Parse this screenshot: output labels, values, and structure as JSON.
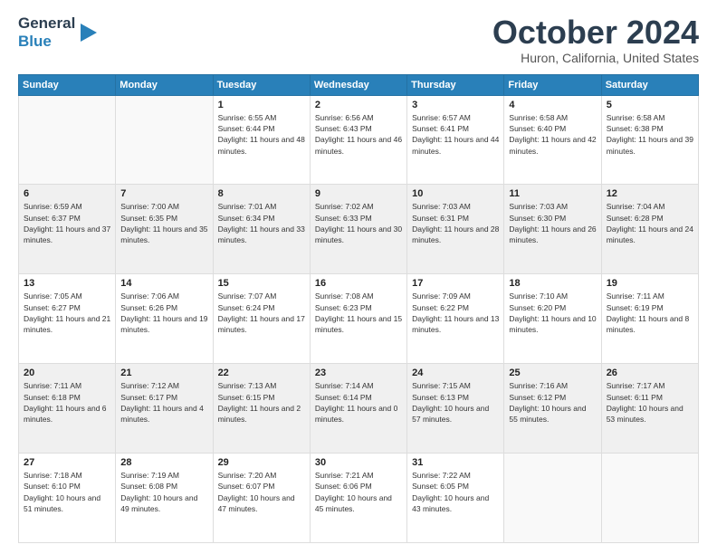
{
  "header": {
    "logo_line1": "General",
    "logo_line2": "Blue",
    "month": "October 2024",
    "location": "Huron, California, United States"
  },
  "days_of_week": [
    "Sunday",
    "Monday",
    "Tuesday",
    "Wednesday",
    "Thursday",
    "Friday",
    "Saturday"
  ],
  "weeks": [
    [
      {
        "day": "",
        "info": ""
      },
      {
        "day": "",
        "info": ""
      },
      {
        "day": "1",
        "info": "Sunrise: 6:55 AM\nSunset: 6:44 PM\nDaylight: 11 hours and 48 minutes."
      },
      {
        "day": "2",
        "info": "Sunrise: 6:56 AM\nSunset: 6:43 PM\nDaylight: 11 hours and 46 minutes."
      },
      {
        "day": "3",
        "info": "Sunrise: 6:57 AM\nSunset: 6:41 PM\nDaylight: 11 hours and 44 minutes."
      },
      {
        "day": "4",
        "info": "Sunrise: 6:58 AM\nSunset: 6:40 PM\nDaylight: 11 hours and 42 minutes."
      },
      {
        "day": "5",
        "info": "Sunrise: 6:58 AM\nSunset: 6:38 PM\nDaylight: 11 hours and 39 minutes."
      }
    ],
    [
      {
        "day": "6",
        "info": "Sunrise: 6:59 AM\nSunset: 6:37 PM\nDaylight: 11 hours and 37 minutes."
      },
      {
        "day": "7",
        "info": "Sunrise: 7:00 AM\nSunset: 6:35 PM\nDaylight: 11 hours and 35 minutes."
      },
      {
        "day": "8",
        "info": "Sunrise: 7:01 AM\nSunset: 6:34 PM\nDaylight: 11 hours and 33 minutes."
      },
      {
        "day": "9",
        "info": "Sunrise: 7:02 AM\nSunset: 6:33 PM\nDaylight: 11 hours and 30 minutes."
      },
      {
        "day": "10",
        "info": "Sunrise: 7:03 AM\nSunset: 6:31 PM\nDaylight: 11 hours and 28 minutes."
      },
      {
        "day": "11",
        "info": "Sunrise: 7:03 AM\nSunset: 6:30 PM\nDaylight: 11 hours and 26 minutes."
      },
      {
        "day": "12",
        "info": "Sunrise: 7:04 AM\nSunset: 6:28 PM\nDaylight: 11 hours and 24 minutes."
      }
    ],
    [
      {
        "day": "13",
        "info": "Sunrise: 7:05 AM\nSunset: 6:27 PM\nDaylight: 11 hours and 21 minutes."
      },
      {
        "day": "14",
        "info": "Sunrise: 7:06 AM\nSunset: 6:26 PM\nDaylight: 11 hours and 19 minutes."
      },
      {
        "day": "15",
        "info": "Sunrise: 7:07 AM\nSunset: 6:24 PM\nDaylight: 11 hours and 17 minutes."
      },
      {
        "day": "16",
        "info": "Sunrise: 7:08 AM\nSunset: 6:23 PM\nDaylight: 11 hours and 15 minutes."
      },
      {
        "day": "17",
        "info": "Sunrise: 7:09 AM\nSunset: 6:22 PM\nDaylight: 11 hours and 13 minutes."
      },
      {
        "day": "18",
        "info": "Sunrise: 7:10 AM\nSunset: 6:20 PM\nDaylight: 11 hours and 10 minutes."
      },
      {
        "day": "19",
        "info": "Sunrise: 7:11 AM\nSunset: 6:19 PM\nDaylight: 11 hours and 8 minutes."
      }
    ],
    [
      {
        "day": "20",
        "info": "Sunrise: 7:11 AM\nSunset: 6:18 PM\nDaylight: 11 hours and 6 minutes."
      },
      {
        "day": "21",
        "info": "Sunrise: 7:12 AM\nSunset: 6:17 PM\nDaylight: 11 hours and 4 minutes."
      },
      {
        "day": "22",
        "info": "Sunrise: 7:13 AM\nSunset: 6:15 PM\nDaylight: 11 hours and 2 minutes."
      },
      {
        "day": "23",
        "info": "Sunrise: 7:14 AM\nSunset: 6:14 PM\nDaylight: 11 hours and 0 minutes."
      },
      {
        "day": "24",
        "info": "Sunrise: 7:15 AM\nSunset: 6:13 PM\nDaylight: 10 hours and 57 minutes."
      },
      {
        "day": "25",
        "info": "Sunrise: 7:16 AM\nSunset: 6:12 PM\nDaylight: 10 hours and 55 minutes."
      },
      {
        "day": "26",
        "info": "Sunrise: 7:17 AM\nSunset: 6:11 PM\nDaylight: 10 hours and 53 minutes."
      }
    ],
    [
      {
        "day": "27",
        "info": "Sunrise: 7:18 AM\nSunset: 6:10 PM\nDaylight: 10 hours and 51 minutes."
      },
      {
        "day": "28",
        "info": "Sunrise: 7:19 AM\nSunset: 6:08 PM\nDaylight: 10 hours and 49 minutes."
      },
      {
        "day": "29",
        "info": "Sunrise: 7:20 AM\nSunset: 6:07 PM\nDaylight: 10 hours and 47 minutes."
      },
      {
        "day": "30",
        "info": "Sunrise: 7:21 AM\nSunset: 6:06 PM\nDaylight: 10 hours and 45 minutes."
      },
      {
        "day": "31",
        "info": "Sunrise: 7:22 AM\nSunset: 6:05 PM\nDaylight: 10 hours and 43 minutes."
      },
      {
        "day": "",
        "info": ""
      },
      {
        "day": "",
        "info": ""
      }
    ]
  ]
}
